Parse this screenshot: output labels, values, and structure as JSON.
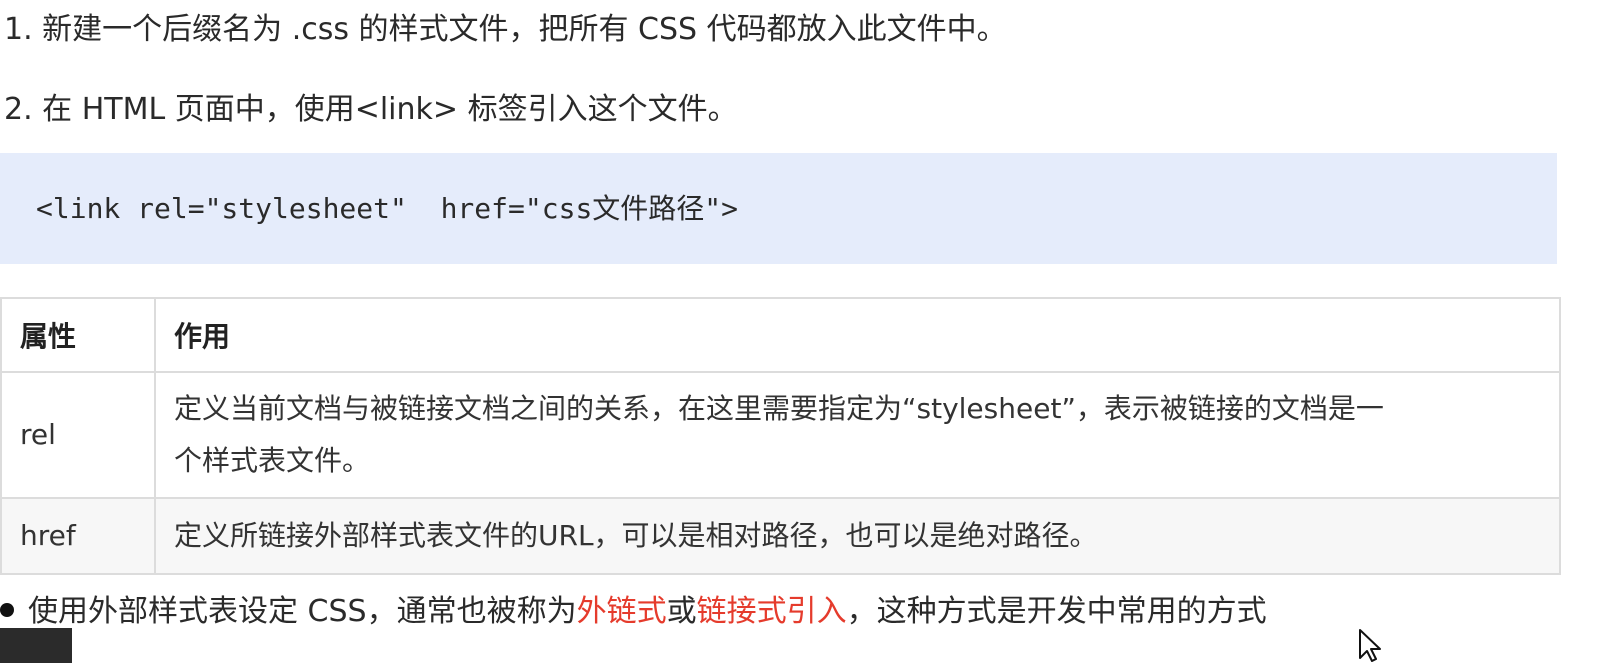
{
  "steps": {
    "step1": "1. 新建一个后缀名为 .css 的样式文件，把所有 CSS 代码都放入此文件中。",
    "step2": "2. 在 HTML 页面中，使用<link> 标签引入这个文件。"
  },
  "code": {
    "line": "<link rel=\"stylesheet\"  href=\"css文件路径\">"
  },
  "table": {
    "headers": [
      "属性",
      "作用"
    ],
    "rows": [
      {
        "attr": "rel",
        "desc_line1": "定义当前文档与被链接文档之间的关系，在这里需要指定为“stylesheet”，表示被链接的文档是一",
        "desc_line2": "个样式表文件。"
      },
      {
        "attr": "href",
        "desc_line1": "定义所链接外部样式表文件的URL，可以是相对路径，也可以是绝对路径。"
      }
    ]
  },
  "bullet": {
    "prefix": "使用外部样式表设定 CSS，通常也被称为",
    "highlight1": "外链式",
    "middle": "或",
    "highlight2": "链接式引入",
    "suffix": "，这种方式是开发中常用的方式"
  },
  "colors": {
    "highlight": "#e53b2c",
    "code_background": "#e5ecfb",
    "table_border": "#dcdcdc"
  },
  "icons": {
    "bullet": "filled-circle",
    "cursor": "mouse-pointer-arrow"
  }
}
